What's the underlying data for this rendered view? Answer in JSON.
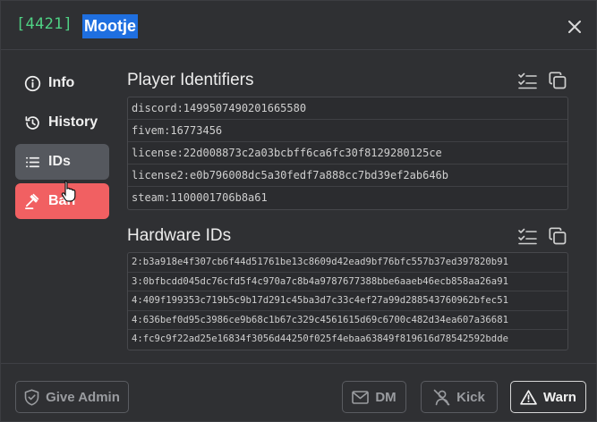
{
  "header": {
    "player_id": "[4421]",
    "player_name": "Mootje"
  },
  "sidebar": {
    "items": [
      {
        "label": "Info",
        "icon": "info-icon"
      },
      {
        "label": "History",
        "icon": "history-icon"
      },
      {
        "label": "IDs",
        "icon": "list-icon",
        "active": true
      },
      {
        "label": "Ban",
        "icon": "gavel-icon",
        "danger": true
      }
    ]
  },
  "player_identifiers": {
    "title": "Player Identifiers",
    "rows": [
      "discord:1499507490201665580",
      "fivem:16773456",
      "license:22d008873c2a03bcbff6ca6fc30f8129280125ce",
      "license2:e0b796008dc5a30fedf7a888cc7bd39ef2ab646b",
      "steam:1100001706b8a61"
    ]
  },
  "hardware_ids": {
    "title": "Hardware IDs",
    "rows": [
      "2:b3a918e4f307cb6f44d51761be13c8609d42ead9bf76bfc557b37ed397820b91",
      "3:0bfbcdd045dc76cfd5f4c970a7c8b4a9787677388bbe6aaeb46ecb858aa26a91",
      "4:409f199353c719b5c9b17d291c45ba3d7c33c4ef27a99d288543760962bfec51",
      "4:636bef0d95c3986ce9b68c1b67c329c4561615d69c6700c482d34ea607a36681",
      "4:fc9c9f22ad25e16834f3056d44250f025f4ebaa63849f819616d78542592bdde"
    ]
  },
  "footer": {
    "give_admin": "Give Admin",
    "dm": "DM",
    "kick": "Kick",
    "warn": "Warn"
  },
  "colors": {
    "background": "#2f3033",
    "player_id": "#4fd184",
    "name_highlight": "#1f6fe0",
    "active_nav": "#55585e",
    "ban": "#f16062"
  }
}
